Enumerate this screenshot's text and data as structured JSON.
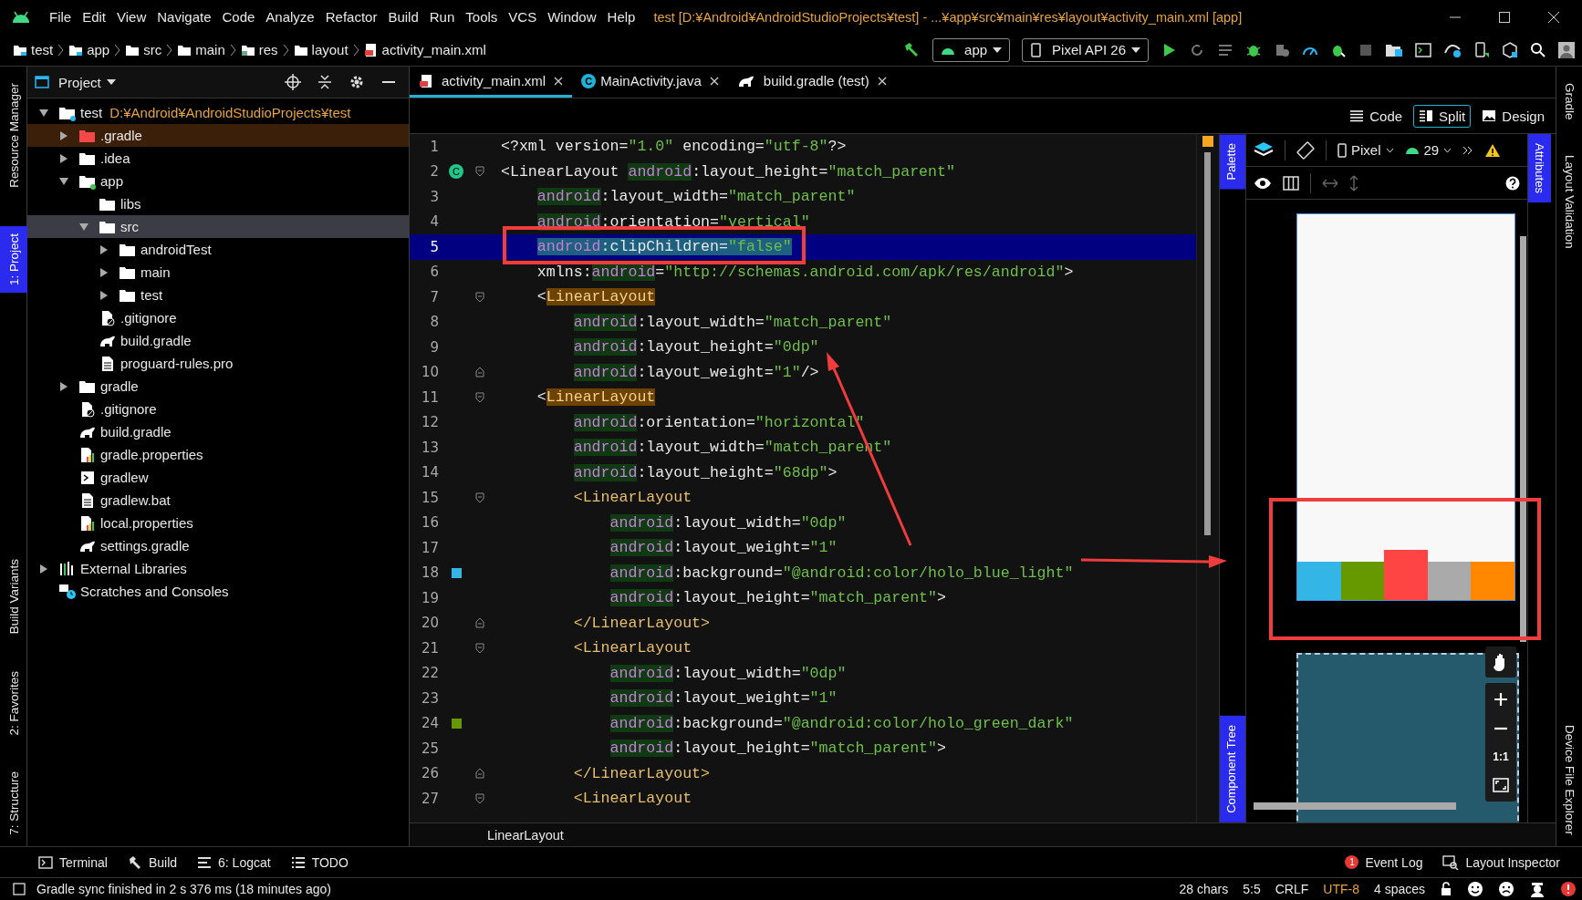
{
  "menu": [
    "File",
    "Edit",
    "View",
    "Navigate",
    "Code",
    "Analyze",
    "Refactor",
    "Build",
    "Run",
    "Tools",
    "VCS",
    "Window",
    "Help"
  ],
  "window": {
    "title": "test [D:¥Android¥AndroidStudioProjects¥test] - ...¥app¥src¥main¥res¥layout¥activity_main.xml [app]"
  },
  "breadcrumbs": [
    {
      "label": "test",
      "kind": "module"
    },
    {
      "label": "app",
      "kind": "module"
    },
    {
      "label": "src",
      "kind": "folder"
    },
    {
      "label": "main",
      "kind": "folder"
    },
    {
      "label": "res",
      "kind": "res"
    },
    {
      "label": "layout",
      "kind": "folder"
    },
    {
      "label": "activity_main.xml",
      "kind": "layout"
    }
  ],
  "run_config": {
    "module": "app",
    "device": "Pixel API 26"
  },
  "left_strip": {
    "top": [
      {
        "label": "Resource Manager",
        "selected": false
      },
      {
        "label": "1: Project",
        "selected": true
      }
    ],
    "bottom": [
      {
        "label": "Build Variants",
        "selected": false
      },
      {
        "label": "2: Favorites",
        "selected": false
      },
      {
        "label": "7: Structure",
        "selected": false
      }
    ]
  },
  "right_strip": {
    "top": [
      "Gradle",
      "Layout Validation"
    ],
    "bottom": [
      "Device File Explorer"
    ]
  },
  "project_panel": {
    "title": "Project"
  },
  "tree": [
    {
      "label": "test",
      "path": "D:¥Android¥AndroidStudioProjects¥test",
      "kind": "module",
      "expanded": true,
      "selected": false,
      "highlighted": false,
      "children": [
        {
          "label": ".gradle",
          "kind": "excluded",
          "expanded": false,
          "selected": false,
          "highlighted": true
        },
        {
          "label": ".idea",
          "kind": "folder",
          "expanded": false,
          "selected": false,
          "highlighted": false
        },
        {
          "label": "app",
          "kind": "module",
          "expanded": true,
          "selected": false,
          "highlighted": false,
          "children": [
            {
              "label": "libs",
              "kind": "folder",
              "selected": false,
              "highlighted": false
            },
            {
              "label": "src",
              "kind": "folder",
              "expanded": true,
              "selected": true,
              "highlighted": false,
              "children": [
                {
                  "label": "androidTest",
                  "kind": "folder",
                  "expanded": false,
                  "selected": false,
                  "highlighted": false
                },
                {
                  "label": "main",
                  "kind": "folder",
                  "expanded": false,
                  "selected": false,
                  "highlighted": false
                },
                {
                  "label": "test",
                  "kind": "folder",
                  "expanded": false,
                  "selected": false,
                  "highlighted": false
                }
              ]
            },
            {
              "label": ".gitignore",
              "kind": "ignore",
              "selected": false,
              "highlighted": false
            },
            {
              "label": "build.gradle",
              "kind": "gradle",
              "selected": false,
              "highlighted": false
            },
            {
              "label": "proguard-rules.pro",
              "kind": "text",
              "selected": false,
              "highlighted": false
            }
          ]
        },
        {
          "label": "gradle",
          "kind": "folder",
          "expanded": false,
          "selected": false,
          "highlighted": false
        },
        {
          "label": ".gitignore",
          "kind": "ignore",
          "selected": false,
          "highlighted": false
        },
        {
          "label": "build.gradle",
          "kind": "gradle",
          "selected": false,
          "highlighted": false
        },
        {
          "label": "gradle.properties",
          "kind": "props",
          "selected": false,
          "highlighted": false
        },
        {
          "label": "gradlew",
          "kind": "script",
          "selected": false,
          "highlighted": false
        },
        {
          "label": "gradlew.bat",
          "kind": "text",
          "selected": false,
          "highlighted": false
        },
        {
          "label": "local.properties",
          "kind": "props",
          "selected": false,
          "highlighted": false
        },
        {
          "label": "settings.gradle",
          "kind": "gradle",
          "selected": false,
          "highlighted": false
        }
      ]
    },
    {
      "label": "External Libraries",
      "kind": "libraries",
      "expanded": false,
      "selected": false,
      "highlighted": false
    },
    {
      "label": "Scratches and Consoles",
      "kind": "scratches",
      "selected": false,
      "highlighted": false
    }
  ],
  "tabs": [
    {
      "label": "activity_main.xml",
      "kind": "layout",
      "selected": true
    },
    {
      "label": "MainActivity.java",
      "kind": "class",
      "badge": "C",
      "selected": false
    },
    {
      "label": "build.gradle (test)",
      "kind": "gradle",
      "selected": false
    }
  ],
  "view_modes": [
    {
      "label": "Code",
      "kind": "code",
      "selected": false
    },
    {
      "label": "Split",
      "kind": "split",
      "selected": true
    },
    {
      "label": "Design",
      "kind": "design",
      "selected": false
    }
  ],
  "code_lines": [
    {
      "number": "1",
      "selected": false,
      "tokens": [
        {
          "text": "<?xml ",
          "kind": "p"
        },
        {
          "text": "version=",
          "kind": "a"
        },
        {
          "text": "\"1.0\"",
          "kind": "s"
        },
        {
          "text": " encoding=",
          "kind": "a"
        },
        {
          "text": "\"utf-8\"",
          "kind": "s"
        },
        {
          "text": "?>",
          "kind": "p"
        }
      ]
    },
    {
      "number": "2",
      "selected": false,
      "badge": "C",
      "kind": "fold_start",
      "tokens": [
        {
          "text": "<LinearLayout ",
          "kind": "p"
        },
        {
          "text": "android",
          "kind": "n"
        },
        {
          "text": ":layout_height=",
          "kind": "a"
        },
        {
          "text": "\"match_parent\"",
          "kind": "s"
        }
      ]
    },
    {
      "number": "3",
      "selected": false,
      "tokens": [
        {
          "text": "    android",
          "kind": "n"
        },
        {
          "text": ":layout_width=",
          "kind": "a"
        },
        {
          "text": "\"match_parent\"",
          "kind": "s"
        }
      ]
    },
    {
      "number": "4",
      "selected": false,
      "tokens": [
        {
          "text": "    android",
          "kind": "n"
        },
        {
          "text": ":orientation=",
          "kind": "a"
        },
        {
          "text": "\"vertical\"",
          "kind": "s"
        }
      ]
    },
    {
      "number": "5",
      "selected": true,
      "tokens": [
        {
          "text": "    android",
          "kind": "n"
        },
        {
          "text": ":clipChildren=",
          "kind": "a"
        },
        {
          "text": "\"false\"",
          "kind": "s"
        }
      ]
    },
    {
      "number": "6",
      "selected": false,
      "tokens": [
        {
          "text": "    xmlns:",
          "kind": "a"
        },
        {
          "text": "android",
          "kind": "n"
        },
        {
          "text": "=",
          "kind": "a"
        },
        {
          "text": "\"http://schemas.android.com/apk/res/android\"",
          "kind": "s"
        },
        {
          "text": ">",
          "kind": "p"
        }
      ]
    },
    {
      "number": "7",
      "selected": false,
      "kind": "fold_start",
      "tokens": [
        {
          "text": "    <",
          "kind": "p"
        },
        {
          "text": "LinearLayout",
          "kind": "th"
        }
      ]
    },
    {
      "number": "8",
      "selected": false,
      "tokens": [
        {
          "text": "        android",
          "kind": "n"
        },
        {
          "text": ":layout_width=",
          "kind": "a"
        },
        {
          "text": "\"match_parent\"",
          "kind": "s"
        }
      ]
    },
    {
      "number": "9",
      "selected": false,
      "tokens": [
        {
          "text": "        android",
          "kind": "n"
        },
        {
          "text": ":layout_height=",
          "kind": "a"
        },
        {
          "text": "\"0dp\"",
          "kind": "s"
        }
      ]
    },
    {
      "number": "10",
      "selected": false,
      "kind": "fold_end",
      "tokens": [
        {
          "text": "        android",
          "kind": "n"
        },
        {
          "text": ":layout_weight=",
          "kind": "a"
        },
        {
          "text": "\"1\"",
          "kind": "s"
        },
        {
          "text": "/>",
          "kind": "p"
        }
      ]
    },
    {
      "number": "11",
      "selected": false,
      "kind": "fold_start",
      "tokens": [
        {
          "text": "    <",
          "kind": "p"
        },
        {
          "text": "LinearLayout",
          "kind": "th"
        }
      ]
    },
    {
      "number": "12",
      "selected": false,
      "tokens": [
        {
          "text": "        android",
          "kind": "n"
        },
        {
          "text": ":orientation=",
          "kind": "a"
        },
        {
          "text": "\"horizontal\"",
          "kind": "s"
        }
      ]
    },
    {
      "number": "13",
      "selected": false,
      "tokens": [
        {
          "text": "        android",
          "kind": "n"
        },
        {
          "text": ":layout_width=",
          "kind": "a"
        },
        {
          "text": "\"match_parent\"",
          "kind": "s"
        }
      ]
    },
    {
      "number": "14",
      "selected": false,
      "tokens": [
        {
          "text": "        android",
          "kind": "n"
        },
        {
          "text": ":layout_height=",
          "kind": "a"
        },
        {
          "text": "\"68dp\"",
          "kind": "s"
        },
        {
          "text": ">",
          "kind": "p"
        }
      ]
    },
    {
      "number": "15",
      "selected": false,
      "kind": "fold_start",
      "tokens": [
        {
          "text": "        <LinearLayout",
          "kind": "t"
        }
      ]
    },
    {
      "number": "16",
      "selected": false,
      "tokens": [
        {
          "text": "            android",
          "kind": "n"
        },
        {
          "text": ":layout_width=",
          "kind": "a"
        },
        {
          "text": "\"0dp\"",
          "kind": "s"
        }
      ]
    },
    {
      "number": "17",
      "selected": false,
      "tokens": [
        {
          "text": "            android",
          "kind": "n"
        },
        {
          "text": ":layout_weight=",
          "kind": "a"
        },
        {
          "text": "\"1\"",
          "kind": "s"
        }
      ]
    },
    {
      "number": "18",
      "selected": false,
      "color": "#33b5e5",
      "tokens": [
        {
          "text": "            android",
          "kind": "n"
        },
        {
          "text": ":background=",
          "kind": "a"
        },
        {
          "text": "\"@android:color/holo_blue_light\"",
          "kind": "s"
        }
      ]
    },
    {
      "number": "19",
      "selected": false,
      "tokens": [
        {
          "text": "            android",
          "kind": "n"
        },
        {
          "text": ":layout_height=",
          "kind": "a"
        },
        {
          "text": "\"match_parent\"",
          "kind": "s"
        },
        {
          "text": ">",
          "kind": "p"
        }
      ]
    },
    {
      "number": "20",
      "selected": false,
      "kind": "fold_end",
      "tokens": [
        {
          "text": "        </LinearLayout>",
          "kind": "t"
        }
      ]
    },
    {
      "number": "21",
      "selected": false,
      "kind": "fold_start",
      "tokens": [
        {
          "text": "        <LinearLayout",
          "kind": "t"
        }
      ]
    },
    {
      "number": "22",
      "selected": false,
      "tokens": [
        {
          "text": "            android",
          "kind": "n"
        },
        {
          "text": ":layout_width=",
          "kind": "a"
        },
        {
          "text": "\"0dp\"",
          "kind": "s"
        }
      ]
    },
    {
      "number": "23",
      "selected": false,
      "tokens": [
        {
          "text": "            android",
          "kind": "n"
        },
        {
          "text": ":layout_weight=",
          "kind": "a"
        },
        {
          "text": "\"1\"",
          "kind": "s"
        }
      ]
    },
    {
      "number": "24",
      "selected": false,
      "color": "#669900",
      "tokens": [
        {
          "text": "            android",
          "kind": "n"
        },
        {
          "text": ":background=",
          "kind": "a"
        },
        {
          "text": "\"@android:color/holo_green_dark\"",
          "kind": "s"
        }
      ]
    },
    {
      "number": "25",
      "selected": false,
      "tokens": [
        {
          "text": "            android",
          "kind": "n"
        },
        {
          "text": ":layout_height=",
          "kind": "a"
        },
        {
          "text": "\"match_parent\"",
          "kind": "s"
        },
        {
          "text": ">",
          "kind": "p"
        }
      ]
    },
    {
      "number": "26",
      "selected": false,
      "kind": "fold_end",
      "tokens": [
        {
          "text": "        </LinearLayout>",
          "kind": "t"
        }
      ]
    },
    {
      "number": "27",
      "selected": false,
      "kind": "fold_start",
      "tokens": [
        {
          "text": "        <LinearLayout",
          "kind": "t"
        }
      ]
    }
  ],
  "editor_breadcrumb": "LinearLayout",
  "design": {
    "palette": "Palette",
    "component_tree": "Component Tree",
    "attributes": "Attributes",
    "device": "Pixel",
    "api": "29",
    "zoom_actual": "1:1",
    "bars": [
      {
        "color": "#33b5e5",
        "overflows": false
      },
      {
        "color": "#669900",
        "overflows": false
      },
      {
        "color": "#ff4444",
        "overflows": true
      },
      {
        "color": "#aaaaaa",
        "overflows": false
      },
      {
        "color": "#ff8800",
        "overflows": false
      }
    ]
  },
  "tool_windows": [
    {
      "label": "Terminal",
      "kind": "terminal"
    },
    {
      "label": "Build",
      "kind": "build"
    },
    {
      "label": "6: Logcat",
      "kind": "logcat"
    },
    {
      "label": "TODO",
      "kind": "todo"
    }
  ],
  "tool_windows_right": [
    {
      "label": "Event Log",
      "kind": "events",
      "badge": "1"
    },
    {
      "label": "Layout Inspector",
      "kind": "inspector"
    }
  ],
  "status_bar": {
    "message": "Gradle sync finished in 2 s 376 ms (18 minutes ago)",
    "items": [
      {
        "text": "28 chars",
        "warning": false
      },
      {
        "text": "5:5",
        "warning": false
      },
      {
        "text": "CRLF",
        "warning": false
      },
      {
        "text": "UTF-8",
        "warning": true
      },
      {
        "text": "4 spaces",
        "warning": false
      }
    ]
  }
}
